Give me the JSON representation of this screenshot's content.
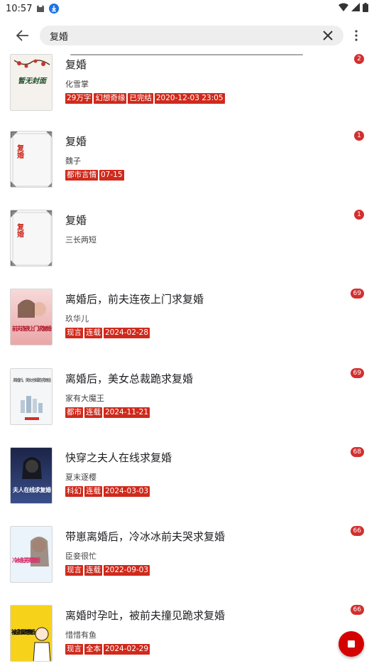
{
  "status_bar": {
    "time": "10:57"
  },
  "search": {
    "value": "复婚",
    "placeholder": ""
  },
  "colors": {
    "accent": "#d50000",
    "tag_bg": "#cf2a1c",
    "badge_bg": "#d32f2f"
  },
  "books": [
    {
      "title": "复婚",
      "author": "化雪掌",
      "tags": [
        "29万字",
        "幻想奇缘",
        "已完结",
        "2020-12-03 23:05"
      ],
      "badge": "2",
      "cover": "no-cover"
    },
    {
      "title": "复婚",
      "author": "魏子",
      "tags": [
        "都市言情",
        "07-15"
      ],
      "badge": "1",
      "cover": "plain-fuhun"
    },
    {
      "title": "复婚",
      "author": "三长两短",
      "tags": [],
      "badge": "1",
      "cover": "plain-fuhun"
    },
    {
      "title": "离婚后，前夫连夜上门求复婚",
      "author": "玖华儿",
      "tags": [
        "现言",
        "连载",
        "2024-02-28"
      ],
      "badge": "69",
      "cover": "romance-pink"
    },
    {
      "title": "离婚后，美女总裁跪求复婚",
      "author": "家有大魔王",
      "tags": [
        "都市",
        "连载",
        "2024-11-21"
      ],
      "badge": "69",
      "cover": "city-white"
    },
    {
      "title": "快穿之夫人在线求复婚",
      "author": "夏末逐樱",
      "tags": [
        "科幻",
        "连载",
        "2024-03-03"
      ],
      "badge": "68",
      "cover": "dark-blue"
    },
    {
      "title": "带崽离婚后，冷冰冰前夫哭求复婚",
      "author": "臣妾很忙",
      "tags": [
        "现言",
        "连载",
        "2022-09-03"
      ],
      "badge": "66",
      "cover": "light-girl"
    },
    {
      "title": "离婚时孕吐，被前夫撞见跪求复婚",
      "author": "惜惜有鱼",
      "tags": [
        "现言",
        "全本",
        "2024-02-29"
      ],
      "badge": "66",
      "cover": "yellow-comic"
    }
  ],
  "covers": {
    "no_cover_text": "暂无封面",
    "plain_text": "复婚",
    "romance_text": "前夫连夜上门求复婚",
    "city_text": "离婚后，美女总裁跪求复婚",
    "dark_text": "夫人在线求复婚",
    "light_text": "冷冰冰前夫哭求复婚",
    "yellow_text": "被前夫撞见跪求复婚"
  }
}
